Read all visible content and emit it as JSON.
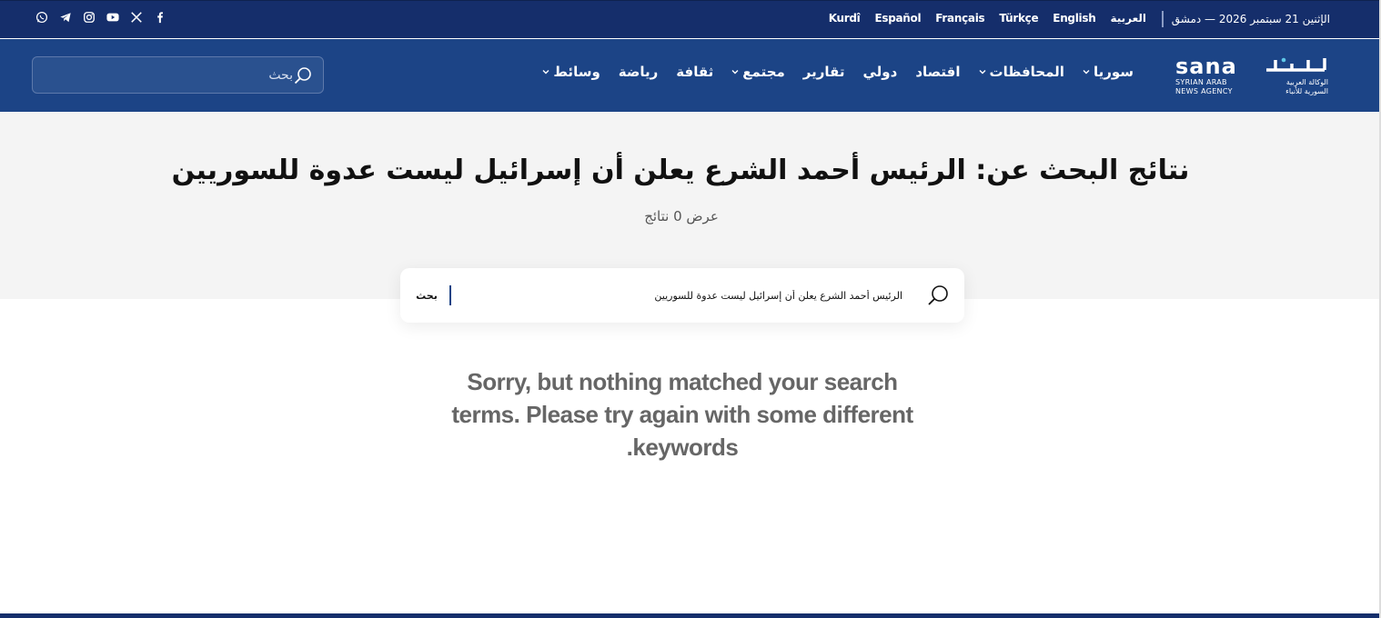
{
  "topbar": {
    "date": "الإثنين 21 سبتمبر 2026 — دمشق",
    "languages": [
      "العربية",
      "English",
      "Türkçe",
      "Français",
      "Español",
      "Kurdî"
    ],
    "social": [
      "whatsapp-icon",
      "telegram-icon",
      "instagram-icon",
      "youtube-icon",
      "x-icon",
      "facebook-icon"
    ]
  },
  "logo": {
    "latin": "sana",
    "line1_en": "SYRIAN ARAB",
    "line2_en": "NEWS AGENCY",
    "line1_ar": "الوكالة العربية",
    "line2_ar": "السورية للأنباء"
  },
  "nav": {
    "items": [
      {
        "label": "سوريا",
        "dropdown": true
      },
      {
        "label": "المحافظات",
        "dropdown": true
      },
      {
        "label": "اقتصاد",
        "dropdown": false
      },
      {
        "label": "دولي",
        "dropdown": false
      },
      {
        "label": "تقارير",
        "dropdown": false
      },
      {
        "label": "مجتمع",
        "dropdown": true
      },
      {
        "label": "ثقافة",
        "dropdown": false
      },
      {
        "label": "رياضة",
        "dropdown": false
      },
      {
        "label": "وسائط",
        "dropdown": true
      }
    ]
  },
  "header_search": {
    "placeholder": "بحث",
    "value": ""
  },
  "results": {
    "title": "نتائج البحث عن: الرئيس أحمد الشرع يعلن أن إسرائيل ليست عدوة للسوريين",
    "count": "عرض 0 نتائج"
  },
  "search_box": {
    "value": "الرئيس أحمد الشرع يعلن أن إسرائيل ليست عدوة للسوريين",
    "button": "بحث"
  },
  "message": "Sorry, but nothing matched your search terms. Please try again with some different keywords.",
  "colors": {
    "topbar": "#152e6b",
    "header": "#1c4486",
    "hero_bg": "#f4f4f4",
    "message": "#666666"
  }
}
